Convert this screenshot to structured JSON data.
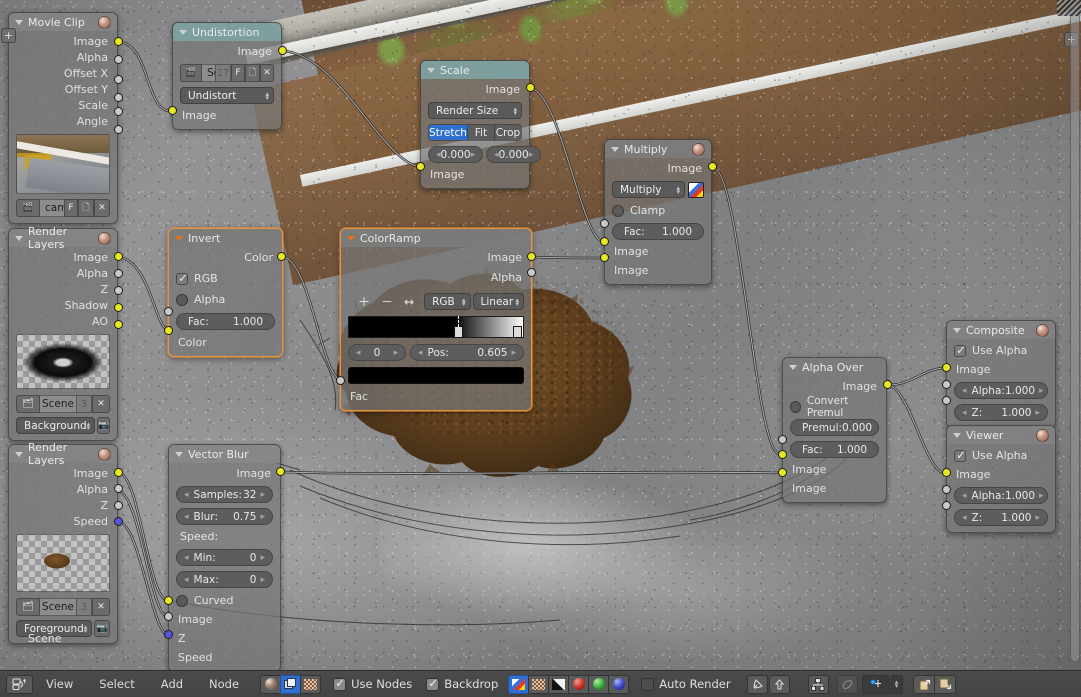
{
  "app": {
    "editor": "Node Editor",
    "scene_label": "Scene"
  },
  "nodes": {
    "movie_clip": {
      "title": "Movie Clip",
      "outputs": [
        "Image",
        "Alpha",
        "Offset X",
        "Offset Y",
        "Scale",
        "Angle"
      ],
      "datablock": {
        "name": "came",
        "fake_user": "F",
        "new_label": "",
        "delete_label": ""
      }
    },
    "undistortion": {
      "title": "Undistortion",
      "outputs": [
        "Image"
      ],
      "inputs": [
        "Image"
      ],
      "datablock": {
        "name": "Sour",
        "count": "17",
        "fake_user": "F"
      },
      "mode": "Undistort"
    },
    "scale": {
      "title": "Scale",
      "outputs": [
        "Image"
      ],
      "inputs": [
        "Image"
      ],
      "space": "Render Size",
      "fit_options": [
        "Stretch",
        "Fit",
        "Crop"
      ],
      "fit_selected": "Stretch",
      "offset_x": "0.000",
      "offset_y": "0.000"
    },
    "multiply": {
      "title": "Multiply",
      "outputs": [
        "Image"
      ],
      "inputs": [
        "Image",
        "Image"
      ],
      "blend_mode": "Multiply",
      "clamp_label": "Clamp",
      "fac_label": "Fac:",
      "fac_value": "1.000"
    },
    "render_layers_bg": {
      "title": "Render Layers",
      "outputs": [
        "Image",
        "Alpha",
        "Z",
        "Shadow",
        "AO"
      ],
      "scene": "Scene",
      "scene_users": "3",
      "layer": "Background"
    },
    "render_layers_fg": {
      "title": "Render Layers",
      "outputs": [
        "Image",
        "Alpha",
        "Z",
        "Speed"
      ],
      "scene": "Scene",
      "scene_users": "3",
      "layer": "Foreground"
    },
    "invert": {
      "title": "Invert",
      "outputs": [
        "Color"
      ],
      "inputs": [
        "Fac",
        "Color"
      ],
      "rgb_label": "RGB",
      "alpha_label": "Alpha",
      "fac_label": "Fac:",
      "fac_value": "1.000"
    },
    "colorramp": {
      "title": "ColorRamp",
      "outputs": [
        "Image",
        "Alpha"
      ],
      "inputs": [
        "Fac"
      ],
      "icons": [
        "plus-icon",
        "minus-icon",
        "flip-icon"
      ],
      "color_mode": "RGB",
      "interpolation": "Linear",
      "index": "0",
      "pos_label": "Pos:",
      "pos_value": "0.605",
      "swatch_color": "#000000",
      "stop_positions": [
        0.605,
        1.0
      ]
    },
    "vector_blur": {
      "title": "Vector Blur",
      "outputs": [
        "Image"
      ],
      "inputs": [
        "Image",
        "Z",
        "Speed"
      ],
      "samples_label": "Samples:",
      "samples_value": "32",
      "blur_label": "Blur:",
      "blur_value": "0.75",
      "speed_label": "Speed:",
      "min_label": "Min:",
      "min_value": "0",
      "max_label": "Max:",
      "max_value": "0",
      "curved_label": "Curved"
    },
    "alpha_over": {
      "title": "Alpha Over",
      "outputs": [
        "Image"
      ],
      "inputs": [
        "Fac",
        "Image",
        "Image"
      ],
      "convert_premul_label": "Convert Premul",
      "premul_label": "Premul:",
      "premul_value": "0.000",
      "fac_label": "Fac:",
      "fac_value": "1.000"
    },
    "composite": {
      "title": "Composite",
      "use_alpha_label": "Use Alpha",
      "inputs": [
        "Image",
        "Alpha",
        "Z"
      ],
      "alpha_label": "Alpha:",
      "alpha_value": "1.000",
      "z_label": "Z:",
      "z_value": "1.000"
    },
    "viewer": {
      "title": "Viewer",
      "use_alpha_label": "Use Alpha",
      "inputs": [
        "Image",
        "Alpha",
        "Z"
      ],
      "alpha_label": "Alpha:",
      "alpha_value": "1.000",
      "z_label": "Z:",
      "z_value": "1.000"
    }
  },
  "bottom_bar": {
    "editor_type_icon": "node-editor-icon",
    "menus": [
      "View",
      "Select",
      "Add",
      "Node"
    ],
    "tree_types": [
      {
        "icon": "material-shader-icon",
        "active": false
      },
      {
        "icon": "compositing-icon",
        "active": true
      },
      {
        "icon": "texture-icon",
        "active": false
      }
    ],
    "use_nodes_label": "Use Nodes",
    "use_nodes_checked": true,
    "backdrop_label": "Backdrop",
    "backdrop_checked": true,
    "channel_buttons": [
      {
        "icon": "color-channel-icon",
        "active": true
      },
      {
        "icon": "alpha-channel-icon",
        "active": false
      },
      {
        "icon": "luma-channel-icon",
        "active": false
      },
      {
        "icon": "red-channel-icon",
        "color": "#c03030",
        "active": false
      },
      {
        "icon": "green-channel-icon",
        "color": "#30b030",
        "active": false
      },
      {
        "icon": "blue-channel-icon",
        "color": "#4040c8",
        "active": false
      }
    ],
    "auto_render_label": "Auto Render",
    "auto_render_checked": false,
    "right_icons": [
      "pin-icon",
      "go-to-parent-icon",
      "snap-nodes-icon",
      "proportional-off-icon",
      "snap-target-icon",
      "copy-to-clipboard-icon",
      "paste-from-clipboard-icon"
    ]
  }
}
